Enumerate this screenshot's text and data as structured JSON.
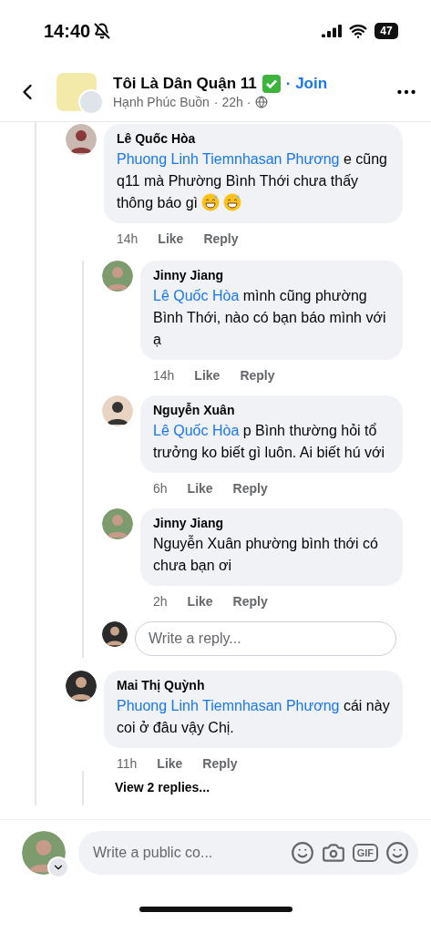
{
  "status_bar": {
    "time": "14:40",
    "muted": true,
    "battery": "47"
  },
  "header": {
    "group_name": "Tôi Là Dân Quận 11",
    "verified": true,
    "join": "· Join",
    "author": "Hạnh Phúc Buồn",
    "time": "· 22h ·"
  },
  "comments": [
    {
      "author": "Lê Quốc Hòa",
      "mention": "Phuong Linh Tiemnhasan Phương",
      "text": "e cũng q11 mà Phường Bình Thới chưa thấy thông báo gì",
      "emojis": [
        {
          "kind": "grin-sweat"
        },
        {
          "kind": "grin-sweat"
        }
      ],
      "time": "14h",
      "like": "Like",
      "reply": "Reply",
      "children": [
        {
          "author": "Jinny Jiang",
          "mention": "Lê Quốc Hòa",
          "text": "mình cũng phường Bình Thới, nào có bạn báo mình với ạ",
          "time": "14h",
          "like": "Like",
          "reply": "Reply"
        },
        {
          "author": "Nguyễn Xuân",
          "mention": "Lê Quốc Hòa",
          "text": "p Bình thường hỏi tổ trưởng ko biết gì luôn. Ai biết hú với",
          "time": "6h",
          "like": "Like",
          "reply": "Reply"
        },
        {
          "author": "Jinny Jiang",
          "text": "Nguyễn Xuân phường bình thới có chưa bạn ơi",
          "time": "2h",
          "like": "Like",
          "reply": "Reply"
        }
      ],
      "reply_box": {
        "placeholder": "Write a reply..."
      }
    },
    {
      "author": "Mai Thị Quỳnh",
      "mention": "Phuong Linh Tiemnhasan Phương",
      "text": "cái này coi ở đâu vậy Chị.",
      "time": "11h",
      "like": "Like",
      "reply": "Reply",
      "view_replies": "View 2 replies..."
    }
  ],
  "composer": {
    "placeholder": "Write a public co...",
    "gif": "GIF"
  }
}
